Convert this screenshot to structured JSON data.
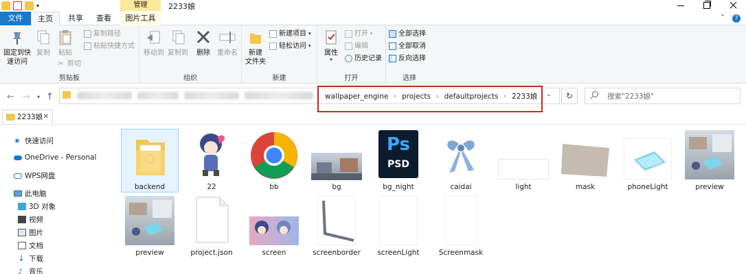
{
  "window": {
    "title": "2233娘",
    "context_tab": "管理",
    "colors": {
      "file_tab": "#1979ca",
      "context_tab": "#fbe99a",
      "highlight_box": "#c4271f",
      "folder": "#f5c64b",
      "selection": "#e5f3ff"
    }
  },
  "tabs": [
    "文件",
    "主页",
    "共享",
    "查看",
    "图片工具"
  ],
  "ribbon": {
    "clipboard": {
      "label": "剪贴板",
      "pin": "固定到快\n速访问",
      "copy": "复制",
      "paste": "粘贴",
      "copy_path": "复制路径",
      "paste_shortcut": "粘贴快捷方式",
      "cut": "剪切"
    },
    "organize": {
      "label": "组织",
      "move_to": "移动到",
      "copy_to": "复制到",
      "delete": "删除",
      "rename": "重命名"
    },
    "new": {
      "label": "新建",
      "new_folder": "新建\n文件夹",
      "new_item": "新建项目",
      "easy_access": "轻松访问"
    },
    "open": {
      "label": "打开",
      "properties": "属性",
      "open": "打开",
      "edit": "编辑",
      "history": "历史记录"
    },
    "select": {
      "label": "选择",
      "select_all": "全部选择",
      "select_none": "全部取消",
      "invert": "反向选择"
    }
  },
  "address": {
    "crumbs": [
      "wallpaper_engine",
      "projects",
      "defaultprojects",
      "2233娘"
    ],
    "search_placeholder": "搜索\"2233娘\""
  },
  "path_tab": "2233娘",
  "sidebar": {
    "items": [
      {
        "label": "快速访问",
        "icon": "star-icon"
      },
      {
        "label": "OneDrive - Personal",
        "icon": "cloud-icon"
      },
      {
        "label": "WPS网盘",
        "icon": "cloud-icon"
      },
      {
        "label": "此电脑",
        "icon": "computer-icon"
      },
      {
        "label": "3D 对象",
        "icon": "cube-icon"
      },
      {
        "label": "视频",
        "icon": "video-icon"
      },
      {
        "label": "图片",
        "icon": "picture-icon"
      },
      {
        "label": "文档",
        "icon": "document-icon"
      },
      {
        "label": "下载",
        "icon": "download-icon"
      },
      {
        "label": "音乐",
        "icon": "music-icon"
      }
    ]
  },
  "files": [
    {
      "name": "backend",
      "kind": "folder"
    },
    {
      "name": "22",
      "kind": "image"
    },
    {
      "name": "bb",
      "kind": "chrome"
    },
    {
      "name": "bg",
      "kind": "image"
    },
    {
      "name": "bg_night",
      "kind": "psd",
      "icon_text": "Ps",
      "icon_sub": "PSD"
    },
    {
      "name": "caidai",
      "kind": "image"
    },
    {
      "name": "light",
      "kind": "image"
    },
    {
      "name": "mask",
      "kind": "image"
    },
    {
      "name": "phoneLight",
      "kind": "image"
    },
    {
      "name": "preview",
      "kind": "image"
    },
    {
      "name": "preview",
      "kind": "image"
    },
    {
      "name": "project.json",
      "kind": "document"
    },
    {
      "name": "screen",
      "kind": "image"
    },
    {
      "name": "screenborder",
      "kind": "image"
    },
    {
      "name": "screenLight",
      "kind": "image"
    },
    {
      "name": "Screenmask",
      "kind": "image"
    }
  ]
}
